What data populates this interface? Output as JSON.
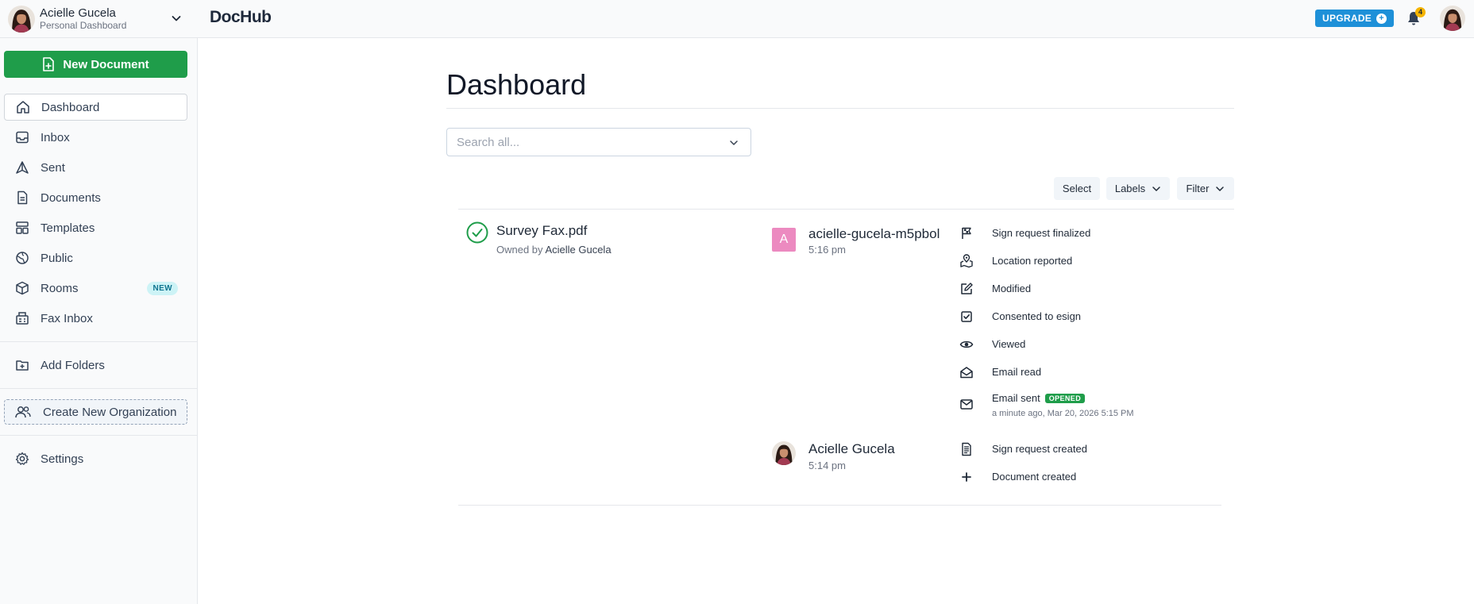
{
  "topbar": {
    "user_name": "Acielle Gucela",
    "user_subtitle": "Personal Dashboard",
    "logo": "DocHub",
    "upgrade_label": "UPGRADE",
    "notification_count": "4",
    "colors": {
      "accent": "#1e90d8",
      "badge": "#f5b400"
    }
  },
  "sidebar": {
    "new_document_label": "New Document",
    "items": [
      {
        "label": "Dashboard",
        "icon": "home-icon",
        "active": true
      },
      {
        "label": "Inbox",
        "icon": "inbox-icon"
      },
      {
        "label": "Sent",
        "icon": "send-icon"
      },
      {
        "label": "Documents",
        "icon": "document-icon"
      },
      {
        "label": "Templates",
        "icon": "templates-icon"
      },
      {
        "label": "Public",
        "icon": "globe-icon"
      },
      {
        "label": "Rooms",
        "icon": "cube-icon",
        "badge": "NEW"
      },
      {
        "label": "Fax Inbox",
        "icon": "fax-icon"
      }
    ],
    "add_folders_label": "Add Folders",
    "create_org_label": "Create New Organization",
    "settings_label": "Settings",
    "colors": {
      "primary": "#1f9d4a"
    }
  },
  "main": {
    "title": "Dashboard",
    "search": {
      "placeholder": "Search all...",
      "value": ""
    },
    "buttons": {
      "select": "Select",
      "labels": "Labels",
      "filter": "Filter"
    },
    "document": {
      "name": "Survey Fax.pdf",
      "owner_prefix": "Owned by",
      "owner_name": "Acielle Gucela",
      "activity": [
        {
          "actor_initial": "A",
          "actor_name": "acielle-gucela-m5pbol",
          "time": "5:16 pm",
          "events": [
            {
              "label": "Sign request finalized",
              "icon": "flag-icon"
            },
            {
              "label": "Location reported",
              "icon": "location-icon"
            },
            {
              "label": "Modified",
              "icon": "edit-icon"
            },
            {
              "label": "Consented to esign",
              "icon": "checkbox-icon"
            },
            {
              "label": "Viewed",
              "icon": "eye-icon"
            },
            {
              "label": "Email read",
              "icon": "envelope-open-icon"
            },
            {
              "label": "Email sent",
              "icon": "envelope-icon",
              "badge": "OPENED",
              "sub": "a minute ago, Mar 20, 2026 5:15 PM"
            }
          ]
        },
        {
          "actor_name": "Acielle Gucela",
          "time": "5:14 pm",
          "events": [
            {
              "label": "Sign request created",
              "icon": "file-text-icon"
            },
            {
              "label": "Document created",
              "icon": "plus-icon"
            }
          ]
        }
      ]
    }
  }
}
